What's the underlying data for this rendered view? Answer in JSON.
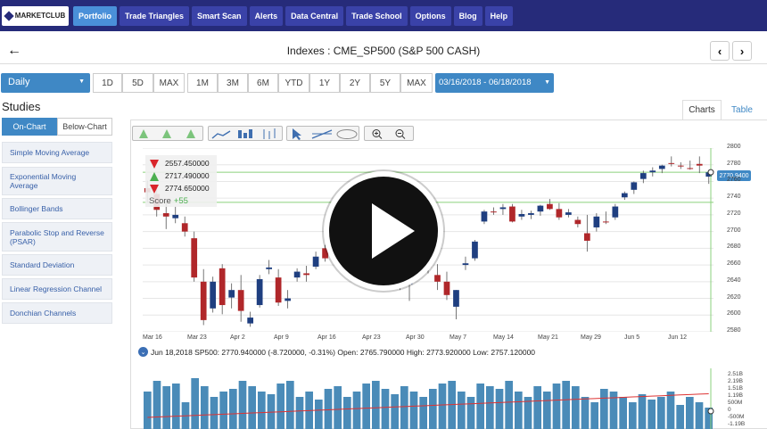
{
  "nav": {
    "logo": "MARKETCLUB",
    "items": [
      "Portfolio",
      "Trade Triangles",
      "Smart Scan",
      "Alerts",
      "Data Central",
      "Trade School",
      "Options",
      "Blog",
      "Help"
    ],
    "active": "Portfolio"
  },
  "header": {
    "title": "Indexes : CME_SP500 (S&P 500 CASH)",
    "prev": "‹",
    "next": "›",
    "back": "←"
  },
  "toolbar": {
    "interval": "Daily",
    "ranges_short": [
      "1D",
      "5D",
      "MAX"
    ],
    "ranges_long": [
      "1M",
      "3M",
      "6M",
      "YTD",
      "1Y",
      "2Y",
      "5Y",
      "MAX"
    ],
    "date_range": "03/16/2018 - 06/18/2018"
  },
  "studies": {
    "heading": "Studies",
    "tabs": [
      "On-Chart",
      "Below-Chart"
    ],
    "items": [
      "Simple Moving Average",
      "Exponential Moving Average",
      "Bollinger Bands",
      "Parabolic Stop and Reverse (PSAR)",
      "Standard Deviation",
      "Linear Regression Channel",
      "Donchian Channels"
    ]
  },
  "view_tabs": [
    "Charts",
    "Table"
  ],
  "chart_info": {
    "lines": [
      "2557.450000",
      "2717.490000",
      "2774.650000"
    ],
    "score_label": "Score",
    "score_value": "+55",
    "price_tag": "2770.9400",
    "legend": "Jun 18,2018 SP500: 2770.940000 (-8.720000, -0.31%) Open: 2765.790000 High: 2773.920000 Low: 2757.120000"
  },
  "chart_data": {
    "type": "candlestick",
    "x_labels": [
      "Mar 16",
      "Mar 23",
      "Apr 2",
      "Apr 9",
      "Apr 16",
      "Apr 23",
      "Apr 30",
      "May 7",
      "May 14",
      "May 21",
      "May 29",
      "Jun 5",
      "Jun 12"
    ],
    "y_ticks": [
      2800,
      2780,
      2760,
      2740,
      2720,
      2700,
      2680,
      2660,
      2640,
      2620,
      2600,
      2580
    ],
    "ylim": [
      2580,
      2800
    ],
    "volume_ticks": [
      "2.51B",
      "2.19B",
      "1.51B",
      "1.19B",
      "500M",
      "0",
      "-500M",
      "-1.19B"
    ],
    "candles": [
      {
        "o": 2752,
        "h": 2761,
        "l": 2735,
        "c": 2747
      },
      {
        "o": 2745,
        "h": 2752,
        "l": 2718,
        "c": 2726
      },
      {
        "o": 2722,
        "h": 2736,
        "l": 2703,
        "c": 2718
      },
      {
        "o": 2716,
        "h": 2730,
        "l": 2710,
        "c": 2720
      },
      {
        "o": 2710,
        "h": 2718,
        "l": 2694,
        "c": 2700
      },
      {
        "o": 2692,
        "h": 2700,
        "l": 2640,
        "c": 2645
      },
      {
        "o": 2640,
        "h": 2655,
        "l": 2588,
        "c": 2594
      },
      {
        "o": 2608,
        "h": 2646,
        "l": 2603,
        "c": 2640
      },
      {
        "o": 2656,
        "h": 2661,
        "l": 2601,
        "c": 2612
      },
      {
        "o": 2621,
        "h": 2638,
        "l": 2608,
        "c": 2630
      },
      {
        "o": 2630,
        "h": 2648,
        "l": 2592,
        "c": 2605
      },
      {
        "o": 2590,
        "h": 2604,
        "l": 2586,
        "c": 2597
      },
      {
        "o": 2612,
        "h": 2648,
        "l": 2609,
        "c": 2643
      },
      {
        "o": 2655,
        "h": 2666,
        "l": 2649,
        "c": 2657
      },
      {
        "o": 2645,
        "h": 2655,
        "l": 2611,
        "c": 2615
      },
      {
        "o": 2617,
        "h": 2630,
        "l": 2608,
        "c": 2620
      },
      {
        "o": 2645,
        "h": 2656,
        "l": 2640,
        "c": 2652
      },
      {
        "o": 2650,
        "h": 2659,
        "l": 2640,
        "c": 2648
      },
      {
        "o": 2658,
        "h": 2676,
        "l": 2655,
        "c": 2670
      },
      {
        "o": 2680,
        "h": 2684,
        "l": 2664,
        "c": 2668
      },
      {
        "o": 2671,
        "h": 2686,
        "l": 2666,
        "c": 2680
      },
      {
        "o": 2698,
        "h": 2708,
        "l": 2692,
        "c": 2706
      },
      {
        "o": 2706,
        "h": 2717,
        "l": 2700,
        "c": 2712
      },
      {
        "o": 2708,
        "h": 2713,
        "l": 2690,
        "c": 2694
      },
      {
        "o": 2693,
        "h": 2698,
        "l": 2682,
        "c": 2695
      },
      {
        "o": 2685,
        "h": 2694,
        "l": 2660,
        "c": 2664
      },
      {
        "o": 2654,
        "h": 2672,
        "l": 2640,
        "c": 2668
      },
      {
        "o": 2663,
        "h": 2671,
        "l": 2630,
        "c": 2637
      },
      {
        "o": 2637,
        "h": 2660,
        "l": 2617,
        "c": 2650
      },
      {
        "o": 2655,
        "h": 2672,
        "l": 2648,
        "c": 2667
      },
      {
        "o": 2660,
        "h": 2674,
        "l": 2650,
        "c": 2657
      },
      {
        "o": 2648,
        "h": 2661,
        "l": 2630,
        "c": 2640
      },
      {
        "o": 2640,
        "h": 2652,
        "l": 2618,
        "c": 2624
      },
      {
        "o": 2610,
        "h": 2630,
        "l": 2595,
        "c": 2630
      },
      {
        "o": 2660,
        "h": 2670,
        "l": 2654,
        "c": 2662
      },
      {
        "o": 2668,
        "h": 2690,
        "l": 2665,
        "c": 2688
      },
      {
        "o": 2712,
        "h": 2726,
        "l": 2709,
        "c": 2724
      },
      {
        "o": 2724,
        "h": 2729,
        "l": 2720,
        "c": 2723
      },
      {
        "o": 2727,
        "h": 2733,
        "l": 2720,
        "c": 2729
      },
      {
        "o": 2730,
        "h": 2733,
        "l": 2711,
        "c": 2712
      },
      {
        "o": 2718,
        "h": 2726,
        "l": 2714,
        "c": 2721
      },
      {
        "o": 2720,
        "h": 2725,
        "l": 2715,
        "c": 2722
      },
      {
        "o": 2724,
        "h": 2732,
        "l": 2719,
        "c": 2731
      },
      {
        "o": 2733,
        "h": 2739,
        "l": 2726,
        "c": 2727
      },
      {
        "o": 2727,
        "h": 2734,
        "l": 2714,
        "c": 2717
      },
      {
        "o": 2720,
        "h": 2727,
        "l": 2717,
        "c": 2723
      },
      {
        "o": 2714,
        "h": 2718,
        "l": 2705,
        "c": 2709
      },
      {
        "o": 2698,
        "h": 2720,
        "l": 2676,
        "c": 2689
      },
      {
        "o": 2705,
        "h": 2722,
        "l": 2700,
        "c": 2718
      },
      {
        "o": 2712,
        "h": 2724,
        "l": 2709,
        "c": 2711
      },
      {
        "o": 2717,
        "h": 2733,
        "l": 2714,
        "c": 2730
      },
      {
        "o": 2741,
        "h": 2748,
        "l": 2738,
        "c": 2746
      },
      {
        "o": 2750,
        "h": 2760,
        "l": 2745,
        "c": 2759
      },
      {
        "o": 2763,
        "h": 2773,
        "l": 2758,
        "c": 2770
      },
      {
        "o": 2771,
        "h": 2777,
        "l": 2766,
        "c": 2773
      },
      {
        "o": 2775,
        "h": 2780,
        "l": 2770,
        "c": 2779
      },
      {
        "o": 2782,
        "h": 2790,
        "l": 2778,
        "c": 2781
      },
      {
        "o": 2779,
        "h": 2783,
        "l": 2775,
        "c": 2778
      },
      {
        "o": 2776,
        "h": 2785,
        "l": 2774,
        "c": 2775
      },
      {
        "o": 2781,
        "h": 2790,
        "l": 2770,
        "c": 2779
      },
      {
        "o": 2765.79,
        "h": 2773.92,
        "l": 2757.12,
        "c": 2770.94
      }
    ],
    "volume": [
      0.7,
      0.9,
      0.8,
      0.85,
      0.5,
      0.95,
      0.8,
      0.6,
      0.7,
      0.75,
      0.9,
      0.8,
      0.7,
      0.65,
      0.85,
      0.9,
      0.6,
      0.7,
      0.55,
      0.75,
      0.8,
      0.6,
      0.7,
      0.85,
      0.9,
      0.75,
      0.65,
      0.8,
      0.7,
      0.6,
      0.75,
      0.85,
      0.9,
      0.7,
      0.6,
      0.85,
      0.8,
      0.75,
      0.9,
      0.7,
      0.6,
      0.8,
      0.7,
      0.85,
      0.9,
      0.8,
      0.6,
      0.5,
      0.75,
      0.7,
      0.6,
      0.5,
      0.65,
      0.55,
      0.6,
      0.7,
      0.45,
      0.6,
      0.5,
      0.4
    ]
  }
}
